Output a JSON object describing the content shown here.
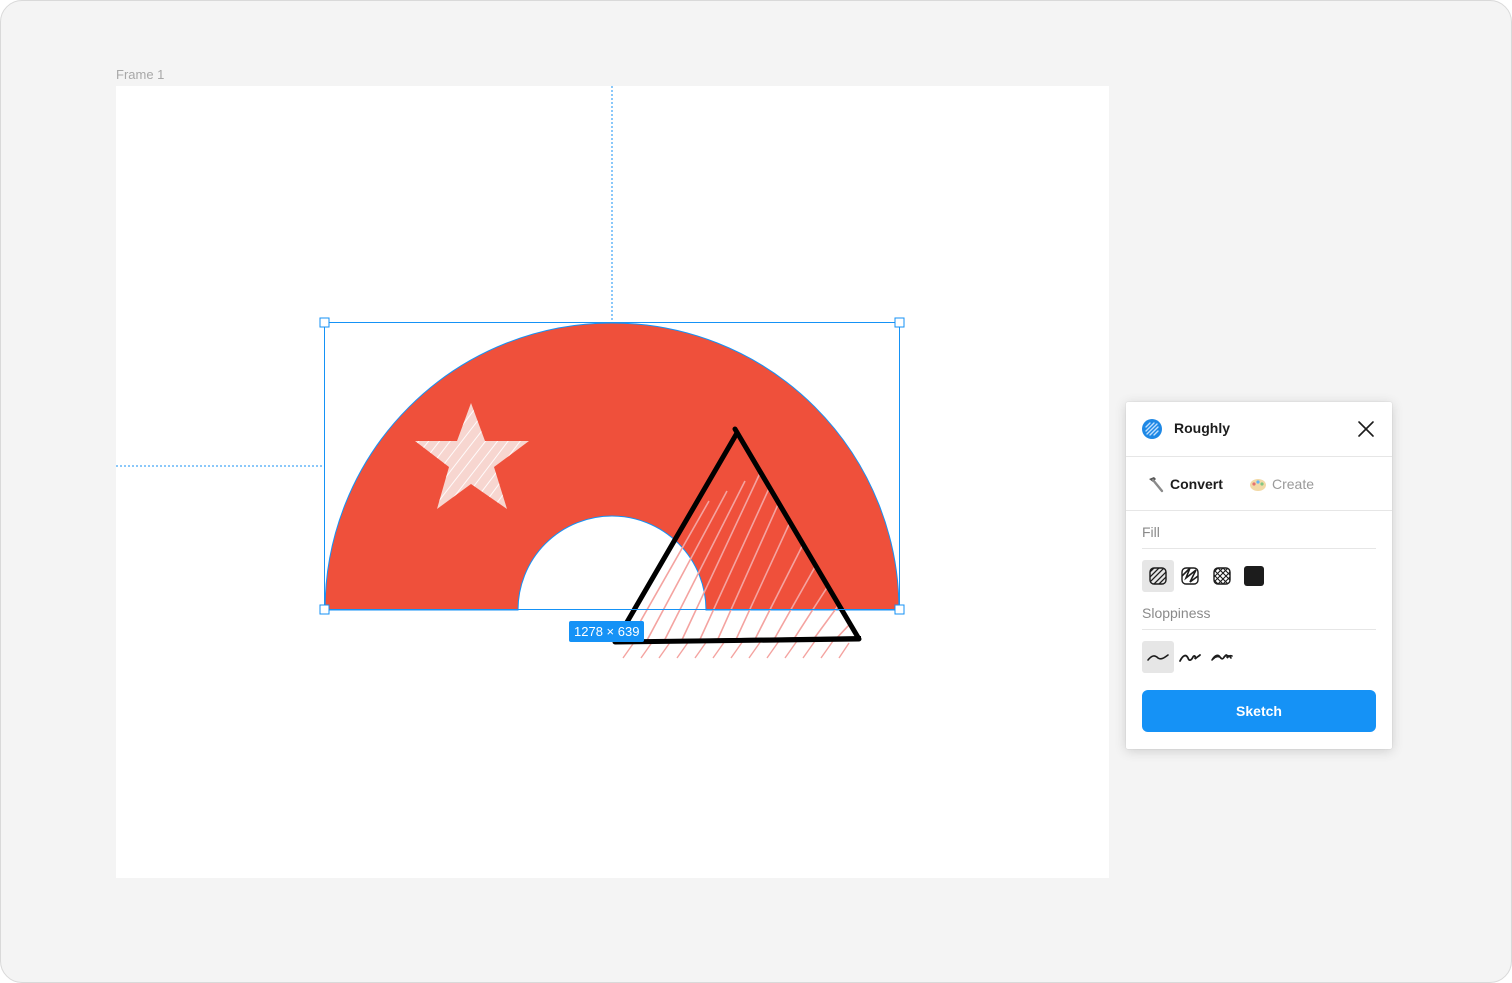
{
  "canvas": {
    "frame_label": "Frame 1",
    "selection_dimensions": "1278 × 639",
    "colors": {
      "shape_red": "#ef503b",
      "selection_blue": "#1592f6",
      "hatch_pink": "#f4a3a0"
    }
  },
  "plugin": {
    "title": "Roughly",
    "icon": "roughly-logo-icon",
    "close_icon": "close-icon",
    "tabs": [
      {
        "label": "Convert",
        "icon": "hammer-icon",
        "active": true
      },
      {
        "label": "Create",
        "icon": "palette-icon",
        "active": false
      }
    ],
    "fill": {
      "label": "Fill",
      "options": [
        {
          "name": "hachure",
          "icon": "hachure-fill-icon",
          "selected": true
        },
        {
          "name": "zigzag",
          "icon": "zigzag-fill-icon",
          "selected": false
        },
        {
          "name": "cross-hatch",
          "icon": "cross-hatch-fill-icon",
          "selected": false
        },
        {
          "name": "solid",
          "icon": "solid-fill-icon",
          "selected": false
        }
      ]
    },
    "sloppiness": {
      "label": "Sloppiness",
      "options": [
        {
          "name": "low",
          "icon": "low-sloppiness-icon",
          "selected": true
        },
        {
          "name": "medium",
          "icon": "medium-sloppiness-icon",
          "selected": false
        },
        {
          "name": "high",
          "icon": "high-sloppiness-icon",
          "selected": false
        }
      ]
    },
    "action_label": "Sketch",
    "accent": "#1592f6"
  }
}
